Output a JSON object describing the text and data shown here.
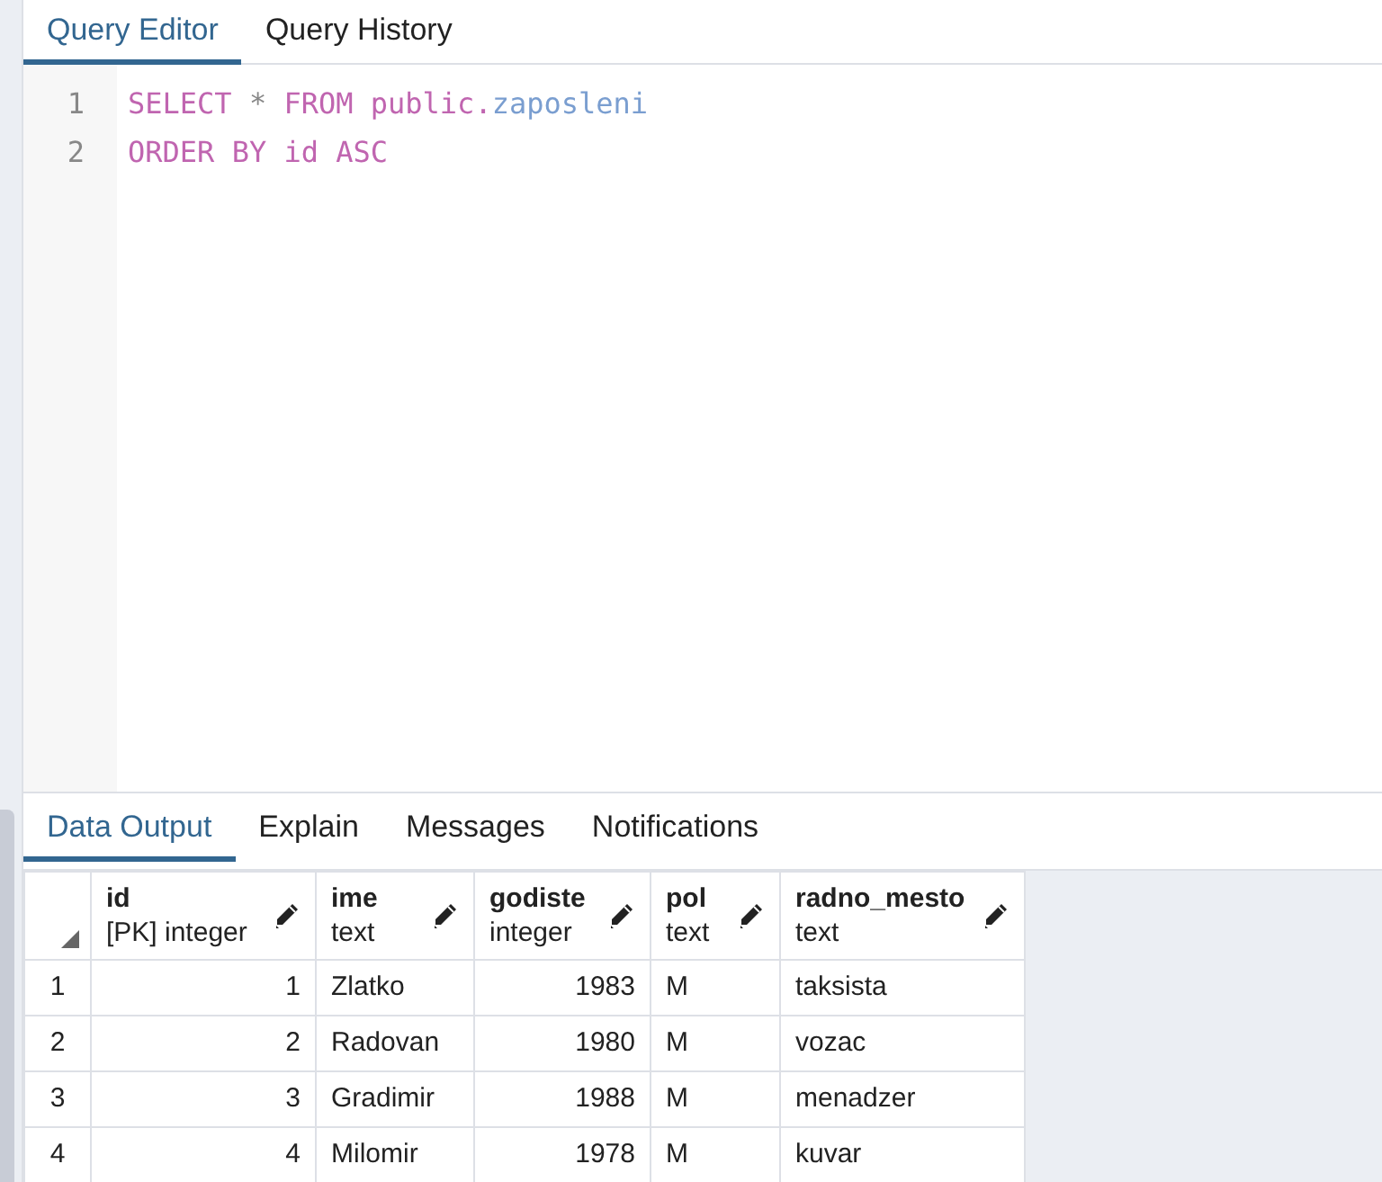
{
  "editor_tabs": [
    {
      "label": "Query Editor",
      "selected": true
    },
    {
      "label": "Query History",
      "selected": false
    }
  ],
  "code_lines": [
    {
      "number": "1",
      "tokens": [
        {
          "text": "SELECT",
          "kind": "keyword"
        },
        {
          "text": "*",
          "kind": "operator"
        },
        {
          "text": "FROM",
          "kind": "keyword"
        },
        {
          "text": "public.",
          "kind": "keyword-join"
        },
        {
          "text": "zaposleni",
          "kind": "identifier"
        }
      ]
    },
    {
      "number": "2",
      "tokens": [
        {
          "text": "ORDER",
          "kind": "keyword"
        },
        {
          "text": "BY",
          "kind": "keyword"
        },
        {
          "text": "id",
          "kind": "keyword"
        },
        {
          "text": "ASC",
          "kind": "keyword"
        }
      ]
    }
  ],
  "output_tabs": [
    {
      "label": "Data Output",
      "selected": true
    },
    {
      "label": "Explain",
      "selected": false
    },
    {
      "label": "Messages",
      "selected": false
    },
    {
      "label": "Notifications",
      "selected": false
    }
  ],
  "table": {
    "columns": [
      {
        "name": "id",
        "type": "[PK] integer",
        "kind": "numeric"
      },
      {
        "name": "ime",
        "type": "text",
        "kind": "textual"
      },
      {
        "name": "godiste",
        "type": "integer",
        "kind": "numeric"
      },
      {
        "name": "pol",
        "type": "text",
        "kind": "textual"
      },
      {
        "name": "radno_mesto",
        "type": "text",
        "kind": "textual"
      }
    ],
    "rows": [
      {
        "number": "1",
        "cells": [
          "1",
          "Zlatko",
          "1983",
          "M",
          "taksista"
        ]
      },
      {
        "number": "2",
        "cells": [
          "2",
          "Radovan",
          "1980",
          "M",
          "vozac"
        ]
      },
      {
        "number": "3",
        "cells": [
          "3",
          "Gradimir",
          "1988",
          "M",
          "menadzer"
        ]
      },
      {
        "number": "4",
        "cells": [
          "4",
          "Milomir",
          "1978",
          "M",
          "kuvar"
        ]
      }
    ]
  }
}
